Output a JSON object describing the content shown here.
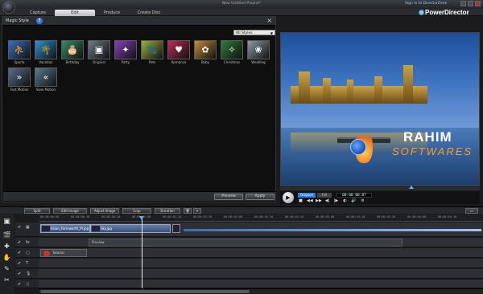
{
  "window": {
    "title": "New Untitled Project*",
    "sign_in": "Sign in to DirectorZone",
    "brand": "PowerDirector"
  },
  "tabs": [
    {
      "label": "Capture",
      "active": false
    },
    {
      "label": "Edit",
      "active": true
    },
    {
      "label": "Produce",
      "active": false
    },
    {
      "label": "Create Disc",
      "active": false
    }
  ],
  "magic_style": {
    "title": "Magic Style",
    "help": "?",
    "filter": "All Styles",
    "items": [
      {
        "label": "Sports",
        "color": "#3b6fc4",
        "icon": "⛹"
      },
      {
        "label": "Vacation",
        "color": "#2e8fd6",
        "icon": "🌴"
      },
      {
        "label": "Birthday",
        "color": "#3a8c6b",
        "icon": "🎂"
      },
      {
        "label": "Original",
        "color": "#6e7b86",
        "icon": "▣"
      },
      {
        "label": "Party",
        "color": "#8a3fbf",
        "icon": "✦"
      },
      {
        "label": "Pets",
        "color": "#9bb23d",
        "icon": "🐾"
      },
      {
        "label": "Romance",
        "color": "#c02a58",
        "icon": "♥"
      },
      {
        "label": "Baby",
        "color": "#c48a3d",
        "icon": "✿"
      },
      {
        "label": "Christmas",
        "color": "#2f7d3a",
        "icon": "✧"
      },
      {
        "label": "Wedding",
        "color": "#8e9aa6",
        "icon": "❀"
      },
      {
        "label": "Fast Motion",
        "color": "#5a6e8f",
        "icon": "»"
      },
      {
        "label": "Slow Motion",
        "color": "#5a7c8f",
        "icon": "«"
      }
    ],
    "preview_button": "Preview",
    "apply_button": "Apply"
  },
  "preview": {
    "watermark_top": "RAHIM",
    "watermark_bottom": "SOFTWARES",
    "mode_original": "Original",
    "mode_full": "Full",
    "timecode": "00:00:00:07",
    "controls": [
      "■",
      "◀◀",
      "▶▶",
      "◀|",
      "|▶",
      "◐",
      "🔊",
      "⚙"
    ]
  },
  "timeline": {
    "toolbar": [
      "Split",
      "Edit Image",
      "Adjust Image",
      "Crop",
      "Duration"
    ],
    "ruler_ticks": [
      "00:00:00:00",
      "00:00:00:10",
      "00:00:00:20",
      "00:00:01:00",
      "00:00:01:10",
      "00:00:01:20",
      "00:00:02:00",
      "00:00:02:10",
      "00:00:02:20",
      "00:00:03:00",
      "00:00:03:10",
      "00:00:03:20",
      "00:00:04:00",
      "00:00:04:10"
    ],
    "clips": [
      {
        "label": "Asian_Farmworth_Pl.jpg"
      },
      {
        "label": "Sky.jpg"
      }
    ],
    "fx_label": "Preview",
    "sub_label": "Tutorial"
  }
}
